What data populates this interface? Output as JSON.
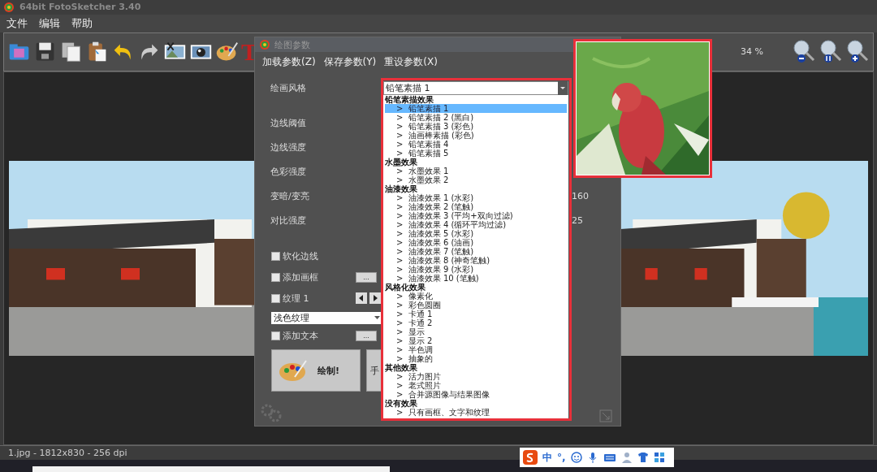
{
  "window": {
    "title": "64bit FotoSketcher 3.40"
  },
  "menu": [
    "文件",
    "编辑",
    "帮助"
  ],
  "toolbar": {
    "text_tool_glyph": "T",
    "zoom": "34 %"
  },
  "dialog": {
    "title": "绘图参数",
    "menu": [
      "加载参数(Z)",
      "保存参数(Y)",
      "重设参数(X)"
    ],
    "style_label": "绘画风格",
    "sliders": [
      {
        "label": "边线阈值"
      },
      {
        "label": "边线强度"
      },
      {
        "label": "色彩强度"
      },
      {
        "label": "变暗/变亮",
        "value": "160"
      },
      {
        "label": "对比强度",
        "value": "25"
      }
    ],
    "options": [
      {
        "kind": "check",
        "label": "软化边线",
        "checked": false
      },
      {
        "kind": "check_more",
        "label": "添加画框",
        "checked": false,
        "button": "..."
      },
      {
        "kind": "check_arrows",
        "label": "纹理 1",
        "checked": false
      },
      {
        "kind": "combo",
        "value": "浅色纹理"
      },
      {
        "kind": "check_more",
        "label": "添加文本",
        "checked": false,
        "button": "..."
      }
    ],
    "buttons": [
      {
        "kind": "draw",
        "label": "绘制!"
      },
      {
        "kind": "plain",
        "label": "手"
      }
    ],
    "style_combo": {
      "value": "铅笔素描 1"
    },
    "style_list": {
      "item_marker": ">",
      "groups": [
        {
          "label": "铅笔素描效果",
          "items": [
            {
              "label": "铅笔素描 1",
              "selected": true
            },
            {
              "label": "铅笔素描 2 (黑白)",
              "selected": false
            },
            {
              "label": "铅笔素描 3 (彩色)",
              "selected": false
            },
            {
              "label": "油画棒素描 (彩色)",
              "selected": false
            },
            {
              "label": "铅笔素描 4",
              "selected": false
            },
            {
              "label": "铅笔素描 5",
              "selected": false
            }
          ]
        },
        {
          "label": "水墨效果",
          "items": [
            {
              "label": "水墨效果 1",
              "selected": false
            },
            {
              "label": "水墨效果 2",
              "selected": false
            }
          ]
        },
        {
          "label": "油漆效果",
          "items": [
            {
              "label": "油漆效果 1 (水彩)",
              "selected": false
            },
            {
              "label": "油漆效果 2 (笔触)",
              "selected": false
            },
            {
              "label": "油漆效果 3 (平均+双向过滤)",
              "selected": false
            },
            {
              "label": "油漆效果 4 (循环平均过滤)",
              "selected": false
            },
            {
              "label": "油漆效果 5 (水彩)",
              "selected": false
            },
            {
              "label": "油漆效果 6 (油画)",
              "selected": false
            },
            {
              "label": "油漆效果 7 (笔触)",
              "selected": false
            },
            {
              "label": "油漆效果 8 (神奇笔触)",
              "selected": false
            },
            {
              "label": "油漆效果 9 (水彩)",
              "selected": false
            },
            {
              "label": "油漆效果 10 (笔触)",
              "selected": false
            }
          ]
        },
        {
          "label": "风格化效果",
          "items": [
            {
              "label": "像素化",
              "selected": false
            },
            {
              "label": "彩色圆圈",
              "selected": false
            },
            {
              "label": "卡通 1",
              "selected": false
            },
            {
              "label": "卡通 2",
              "selected": false
            },
            {
              "label": "显示",
              "selected": false
            },
            {
              "label": "显示 2",
              "selected": false
            },
            {
              "label": "半色调",
              "selected": false
            },
            {
              "label": "抽象的",
              "selected": false
            }
          ]
        },
        {
          "label": "其他效果",
          "items": [
            {
              "label": "活力图片",
              "selected": false
            },
            {
              "label": "老式照片",
              "selected": false
            },
            {
              "label": "合并源图像与结果图像",
              "selected": false
            }
          ]
        },
        {
          "label": "没有效果",
          "items": [
            {
              "label": "只有画框、文字和纹理",
              "selected": false
            }
          ]
        }
      ]
    }
  },
  "status_bar": {
    "text": "1.jpg - 1812x830 - 256 dpi"
  },
  "ime_bar": {
    "mode": "中",
    "punct": "°,"
  }
}
